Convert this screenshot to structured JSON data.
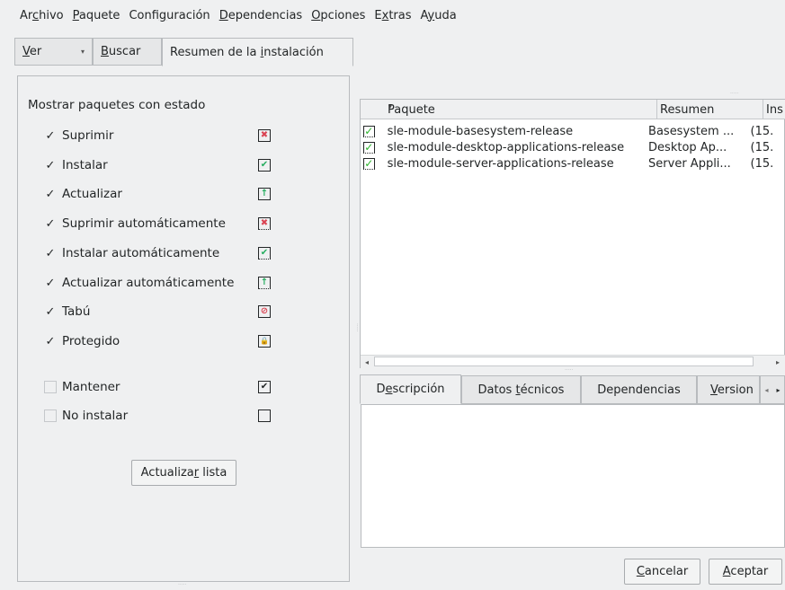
{
  "menubar": {
    "items": [
      {
        "pre": "Ar",
        "key": "c",
        "post": "hivo"
      },
      {
        "pre": "",
        "key": "P",
        "post": "aquete"
      },
      {
        "pre": "Confi",
        "key": "g",
        "post": "uración"
      },
      {
        "pre": "",
        "key": "D",
        "post": "ependencias"
      },
      {
        "pre": "",
        "key": "O",
        "post": "pciones"
      },
      {
        "pre": "E",
        "key": "x",
        "post": "tras"
      },
      {
        "pre": "A",
        "key": "y",
        "post": "uda"
      }
    ]
  },
  "view_tabs": {
    "ver": {
      "key": "V",
      "post": "er"
    },
    "buscar": {
      "key": "B",
      "post": "uscar"
    },
    "resumen": {
      "pre": "Resumen de la ",
      "key": "i",
      "post": "nstalación"
    }
  },
  "filters": {
    "heading": "Mostrar paquetes con estado",
    "items": [
      {
        "label": "Suprimir",
        "checked": "✓",
        "icon": "delete-icon",
        "glyph": "✖",
        "color": "#da4453"
      },
      {
        "label": "Instalar",
        "checked": "✓",
        "icon": "install-icon",
        "glyph": "✔",
        "color": "#27ae60"
      },
      {
        "label": "Actualizar",
        "checked": "✓",
        "icon": "update-icon",
        "glyph": "↑",
        "color": "#27ae60"
      },
      {
        "label": "Suprimir automáticamente",
        "checked": "✓",
        "icon": "auto-delete-icon",
        "glyph": "✖",
        "color": "#da4453"
      },
      {
        "label": "Instalar automáticamente",
        "checked": "✓",
        "icon": "auto-install-icon",
        "glyph": "✔",
        "color": "#27ae60"
      },
      {
        "label": "Actualizar automáticamente",
        "checked": "✓",
        "icon": "auto-update-icon",
        "glyph": "↑",
        "color": "#27ae60"
      },
      {
        "label": "Tabú",
        "checked": "✓",
        "icon": "taboo-icon",
        "glyph": "⊘",
        "color": "#da4453"
      },
      {
        "label": "Protegido",
        "checked": "✓",
        "icon": "lock-icon",
        "glyph": "🔒",
        "color": "#232627"
      },
      {
        "label": "Mantener",
        "checked": "",
        "icon": "keep-icon",
        "glyph": "✔",
        "color": "#232627"
      },
      {
        "label": "No instalar",
        "checked": "",
        "icon": "no-install-icon",
        "glyph": "",
        "color": "#232627"
      }
    ],
    "refresh": {
      "pre": "Actualiza",
      "key": "r",
      "post": " lista"
    }
  },
  "package_table": {
    "columns": [
      "Paquete",
      "Resumen",
      "Ins"
    ],
    "rows": [
      {
        "name": "sle-module-basesystem-release",
        "summary": "Basesystem ...",
        "install": "(15."
      },
      {
        "name": "sle-module-desktop-applications-release",
        "summary": "Desktop Ap...",
        "install": "(15."
      },
      {
        "name": "sle-module-server-applications-release",
        "summary": "Server Appli...",
        "install": "(15."
      }
    ]
  },
  "detail_tabs": {
    "desc": {
      "pre": "D",
      "key": "e",
      "post": "scripción"
    },
    "tech": {
      "pre": "Datos ",
      "key": "t",
      "post": "écnicos"
    },
    "deps": {
      "pre": "Dependencias",
      "key": "",
      "post": ""
    },
    "vers": {
      "pre": "",
      "key": "V",
      "post": "ersion"
    }
  },
  "buttons": {
    "cancel": {
      "pre": "",
      "key": "C",
      "post": "ancelar"
    },
    "accept": {
      "pre": "",
      "key": "A",
      "post": "ceptar"
    }
  }
}
